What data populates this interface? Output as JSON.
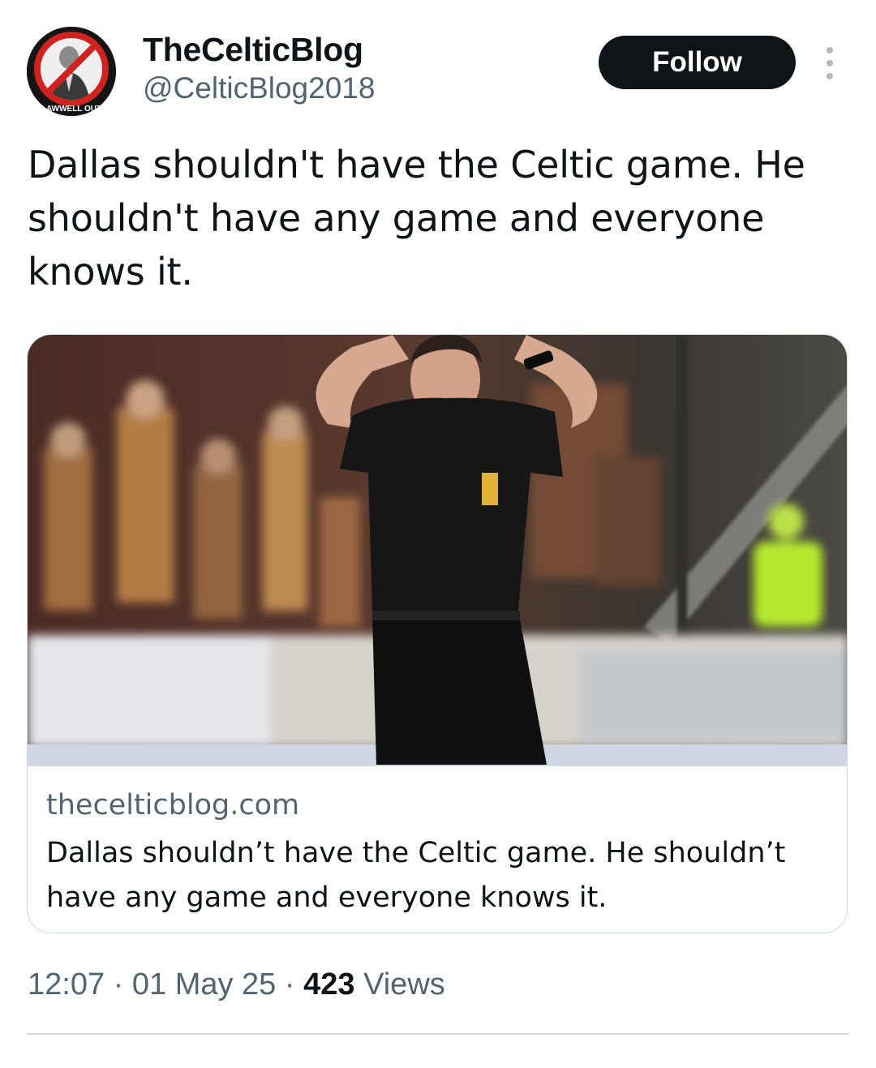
{
  "author": {
    "display_name": "TheCelticBlog",
    "handle": "@CelticBlog2018",
    "avatar_text": "LAWWELL OUT"
  },
  "follow_label": "Follow",
  "tweet": {
    "text": "Dallas shouldn't have the Celtic game. He shouldn't have any game and everyone knows it."
  },
  "link_card": {
    "domain": "thecelticblog.com",
    "title": "Dallas shouldn’t have the Celtic game. He shouldn’t have any game and everyone knows it."
  },
  "meta": {
    "time": "12:07",
    "separator": "·",
    "date": "01 May 25",
    "views_count": "423",
    "views_label": "Views"
  },
  "colors": {
    "text_primary": "#0f1419",
    "text_secondary": "#536471",
    "border": "#cfd9de",
    "follow_bg": "#0f1419",
    "avatar_ring": "#d0231f"
  },
  "icons": {
    "more": "more-vertical-icon",
    "avatar": "crossed-out-portrait"
  }
}
